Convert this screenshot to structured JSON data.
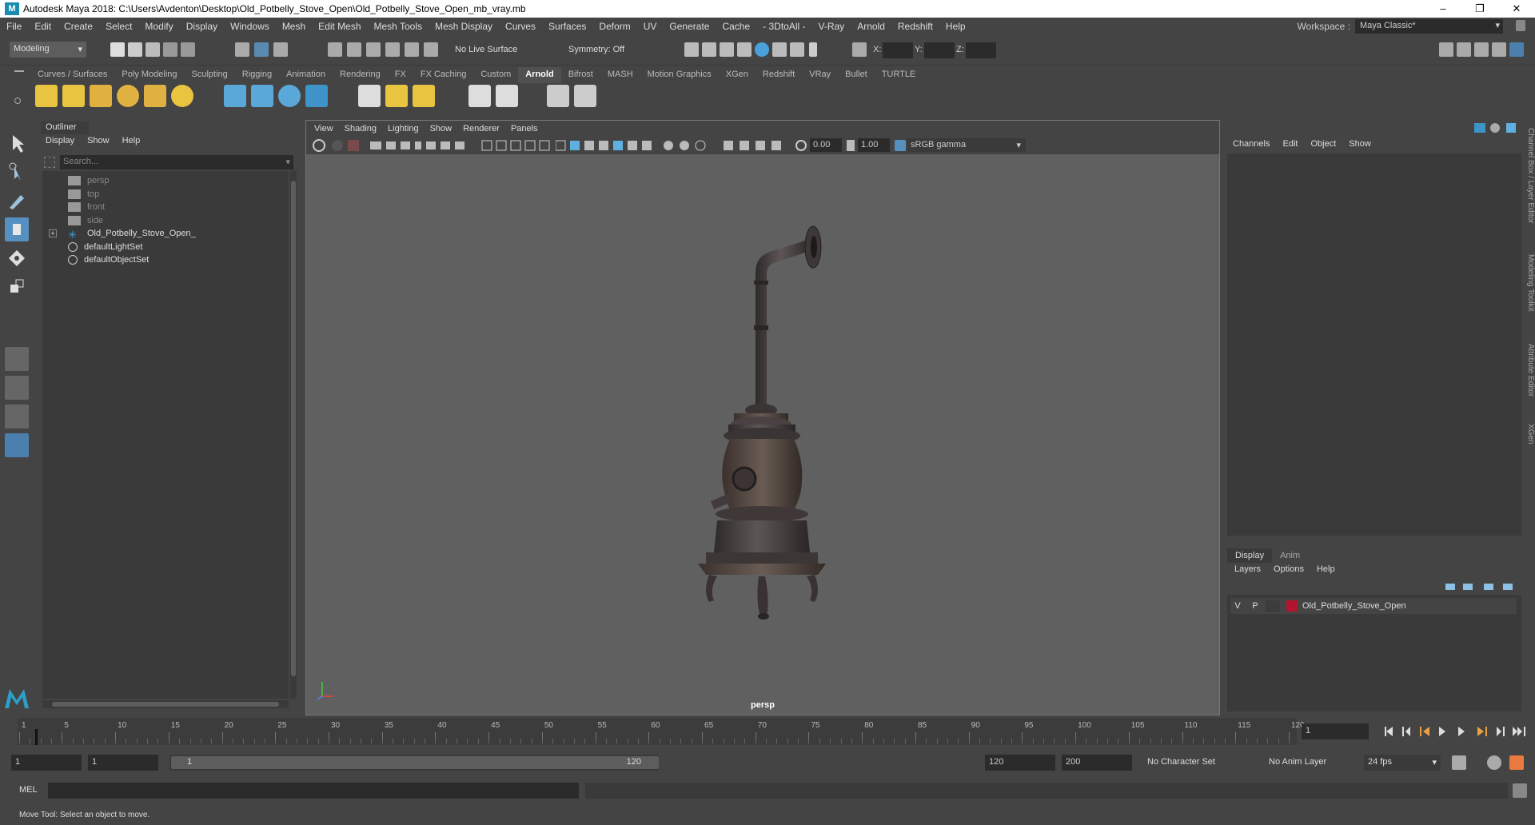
{
  "title": "Autodesk Maya 2018: C:\\Users\\Avdenton\\Desktop\\Old_Potbelly_Stove_Open\\Old_Potbelly_Stove_Open_mb_vray.mb",
  "window_buttons": {
    "minimize": "–",
    "maximize": "❐",
    "close": "✕"
  },
  "menu": [
    "File",
    "Edit",
    "Create",
    "Select",
    "Modify",
    "Display",
    "Windows",
    "Mesh",
    "Edit Mesh",
    "Mesh Tools",
    "Mesh Display",
    "Curves",
    "Surfaces",
    "Deform",
    "UV",
    "Generate",
    "Cache",
    "- 3DtoAll -",
    "V-Ray",
    "Arnold",
    "Redshift",
    "Help"
  ],
  "workspace": {
    "label": "Workspace :",
    "value": "Maya Classic*"
  },
  "status": {
    "menuset": "Modeling",
    "live_surface": "No Live Surface",
    "symmetry": "Symmetry: Off",
    "x_label": "X:",
    "y_label": "Y:",
    "z_label": "Z:"
  },
  "shelf_tabs": [
    "Curves / Surfaces",
    "Poly Modeling",
    "Sculpting",
    "Rigging",
    "Animation",
    "Rendering",
    "FX",
    "FX Caching",
    "Custom",
    "Arnold",
    "Bifrost",
    "MASH",
    "Motion Graphics",
    "XGen",
    "Redshift",
    "VRay",
    "Bullet",
    "TURTLE"
  ],
  "shelf_active": "Arnold",
  "outliner": {
    "title": "Outliner",
    "menu": [
      "Display",
      "Show",
      "Help"
    ],
    "search_placeholder": "Search...",
    "items": [
      {
        "label": "persp",
        "dim": true,
        "icon": "camera-icon"
      },
      {
        "label": "top",
        "dim": true,
        "icon": "camera-icon"
      },
      {
        "label": "front",
        "dim": true,
        "icon": "camera-icon"
      },
      {
        "label": "side",
        "dim": true,
        "icon": "camera-icon"
      },
      {
        "label": "Old_Potbelly_Stove_Open_",
        "dim": false,
        "icon": "group-icon",
        "expand": "+"
      },
      {
        "label": "defaultLightSet",
        "dim": false,
        "icon": "set-icon"
      },
      {
        "label": "defaultObjectSet",
        "dim": false,
        "icon": "set-icon"
      }
    ]
  },
  "viewport": {
    "menu": [
      "View",
      "Shading",
      "Lighting",
      "Show",
      "Renderer",
      "Panels"
    ],
    "exposure": "0.00",
    "gamma": "1.00",
    "colorspace": "sRGB gamma",
    "camera_label": "persp"
  },
  "channelbox": {
    "menu": [
      "Channels",
      "Edit",
      "Object",
      "Show"
    ],
    "layer_tabs": [
      "Display",
      "Anim"
    ],
    "layer_menu": [
      "Layers",
      "Options",
      "Help"
    ],
    "layer": {
      "v": "V",
      "p": "P",
      "name": "Old_Potbelly_Stove_Open",
      "color": "#b4152e"
    }
  },
  "side_tabs": [
    "Channel Box / Layer Editor",
    "Modeling Toolkit",
    "Attribute Editor",
    "XGen"
  ],
  "timeline": {
    "ticks": [
      1,
      5,
      10,
      15,
      20,
      25,
      30,
      35,
      40,
      45,
      50,
      55,
      60,
      65,
      70,
      75,
      80,
      85,
      90,
      95,
      100,
      105,
      110,
      115,
      120
    ],
    "current_frame": "1"
  },
  "range": {
    "start": "1",
    "start2": "1",
    "slider_start": "1",
    "slider_end": "120",
    "end": "120",
    "end2": "200",
    "character_set": "No Character Set",
    "anim_layer": "No Anim Layer",
    "fps": "24 fps"
  },
  "cmdline": {
    "label": "MEL"
  },
  "helpline": "Move Tool: Select an object to move."
}
